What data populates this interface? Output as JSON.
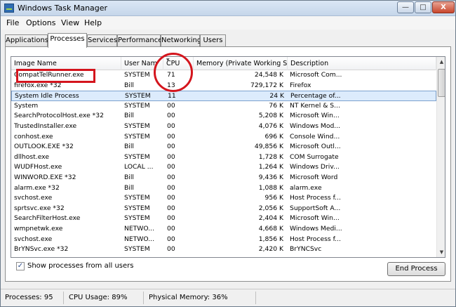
{
  "window": {
    "title": "Windows Task Manager"
  },
  "titlebar_buttons": {
    "minimize": "—",
    "maximize": "□",
    "close": "X"
  },
  "menu": [
    "File",
    "Options",
    "View",
    "Help"
  ],
  "tabs": [
    "Applications",
    "Processes",
    "Services",
    "Performance",
    "Networking",
    "Users"
  ],
  "active_tab": "Processes",
  "columns": {
    "image_name": "Image Name",
    "user_name": "User Nam",
    "cpu": "CPU",
    "memory": "Memory (Private Working Set)",
    "description": "Description"
  },
  "processes": [
    {
      "name": "CompatTelRunner.exe",
      "user": "SYSTEM",
      "cpu": "71",
      "memory": "24,548 K",
      "description": "Microsoft Com..."
    },
    {
      "name": "firefox.exe *32",
      "user": "Bill",
      "cpu": "13",
      "memory": "729,172 K",
      "description": "Firefox"
    },
    {
      "name": "System Idle Process",
      "user": "SYSTEM",
      "cpu": "11",
      "memory": "24 K",
      "description": "Percentage of..."
    },
    {
      "name": "System",
      "user": "SYSTEM",
      "cpu": "00",
      "memory": "76 K",
      "description": "NT Kernel & S..."
    },
    {
      "name": "SearchProtocolHost.exe *32",
      "user": "Bill",
      "cpu": "00",
      "memory": "5,208 K",
      "description": "Microsoft Win..."
    },
    {
      "name": "TrustedInstaller.exe",
      "user": "SYSTEM",
      "cpu": "00",
      "memory": "4,076 K",
      "description": "Windows Mod..."
    },
    {
      "name": "conhost.exe",
      "user": "SYSTEM",
      "cpu": "00",
      "memory": "696 K",
      "description": "Console Wind..."
    },
    {
      "name": "OUTLOOK.EXE *32",
      "user": "Bill",
      "cpu": "00",
      "memory": "49,856 K",
      "description": "Microsoft Outl..."
    },
    {
      "name": "dllhost.exe",
      "user": "SYSTEM",
      "cpu": "00",
      "memory": "1,728 K",
      "description": "COM Surrogate"
    },
    {
      "name": "WUDFHost.exe",
      "user": "LOCAL ...",
      "cpu": "00",
      "memory": "1,264 K",
      "description": "Windows Driv..."
    },
    {
      "name": "WINWORD.EXE *32",
      "user": "Bill",
      "cpu": "00",
      "memory": "9,436 K",
      "description": "Microsoft Word"
    },
    {
      "name": "alarm.exe *32",
      "user": "Bill",
      "cpu": "00",
      "memory": "1,088 K",
      "description": "alarm.exe"
    },
    {
      "name": "svchost.exe",
      "user": "SYSTEM",
      "cpu": "00",
      "memory": "956 K",
      "description": "Host Process f..."
    },
    {
      "name": "sprtsvc.exe *32",
      "user": "SYSTEM",
      "cpu": "00",
      "memory": "2,056 K",
      "description": "SupportSoft A..."
    },
    {
      "name": "SearchFilterHost.exe",
      "user": "SYSTEM",
      "cpu": "00",
      "memory": "2,404 K",
      "description": "Microsoft Win..."
    },
    {
      "name": "wmpnetwk.exe",
      "user": "NETWO...",
      "cpu": "00",
      "memory": "4,668 K",
      "description": "Windows Medi..."
    },
    {
      "name": "svchost.exe",
      "user": "NETWO...",
      "cpu": "00",
      "memory": "1,856 K",
      "description": "Host Process f..."
    },
    {
      "name": "BrYNSvc.exe *32",
      "user": "SYSTEM",
      "cpu": "00",
      "memory": "2,420 K",
      "description": "BrYNCSvc"
    }
  ],
  "selected_process": "System Idle Process",
  "show_all": {
    "label": "Show processes from all users",
    "checked": true
  },
  "end_process_label": "End Process",
  "status": {
    "processes": "Processes: 95",
    "cpu_usage": "CPU Usage: 89%",
    "physical_memory": "Physical Memory: 36%"
  },
  "annotation_color": "#d4151d"
}
